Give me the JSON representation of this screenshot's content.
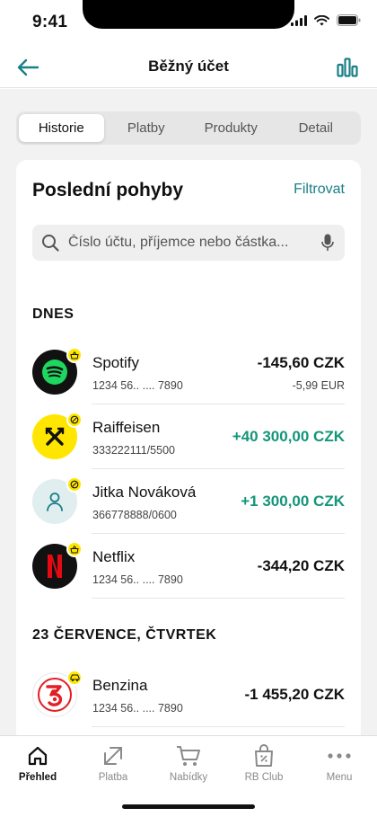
{
  "status": {
    "time": "9:41"
  },
  "header": {
    "title": "Běžný účet"
  },
  "tabs": [
    {
      "label": "Historie",
      "active": true
    },
    {
      "label": "Platby",
      "active": false
    },
    {
      "label": "Produkty",
      "active": false
    },
    {
      "label": "Detail",
      "active": false
    }
  ],
  "card": {
    "title": "Poslední pohyby",
    "filter_label": "Filtrovat",
    "search_placeholder": "Číslo účtu, příjemce nebo částka..."
  },
  "sections": [
    {
      "header": "DNES",
      "transactions": [
        {
          "name": "Spotify",
          "sub": "1234 56.. .... 7890",
          "amount": "-145,60 CZK",
          "subamount": "-5,99 EUR",
          "icon": "spotify-logo",
          "badge": "basket-icon"
        },
        {
          "name": "Raiffeisen",
          "sub": "333222111/5500",
          "amount": "+40 300,00 CZK",
          "icon": "raiffeisen-logo",
          "badge": "slash-circle-icon"
        },
        {
          "name": "Jitka Nováková",
          "sub": "366778888/0600",
          "amount": "+1 300,00 CZK",
          "icon": "person-icon",
          "badge": "slash-circle-icon"
        },
        {
          "name": "Netflix",
          "sub": "1234 56.. .... 7890",
          "amount": "-344,20 CZK",
          "icon": "netflix-logo",
          "badge": "basket-icon"
        }
      ]
    },
    {
      "header": "23 ČERVENCE, ČTVRTEK",
      "transactions": [
        {
          "name": "Benzina",
          "sub": "1234 56.. .... 7890",
          "amount": "-1 455,20 CZK",
          "icon": "benzina-logo",
          "badge": "car-icon"
        }
      ]
    }
  ],
  "nav": [
    {
      "label": "Přehled",
      "icon": "home-icon",
      "active": true
    },
    {
      "label": "Platba",
      "icon": "transfer-arrows-icon",
      "active": false
    },
    {
      "label": "Nabídky",
      "icon": "cart-icon",
      "active": false
    },
    {
      "label": "RB Club",
      "icon": "gift-bag-icon",
      "active": false
    },
    {
      "label": "Menu",
      "icon": "more-dots-icon",
      "active": false
    }
  ],
  "colors": {
    "accent": "#1a7f86",
    "positive": "#14957a",
    "badge": "#ffe600",
    "background": "#f2f2f2"
  }
}
